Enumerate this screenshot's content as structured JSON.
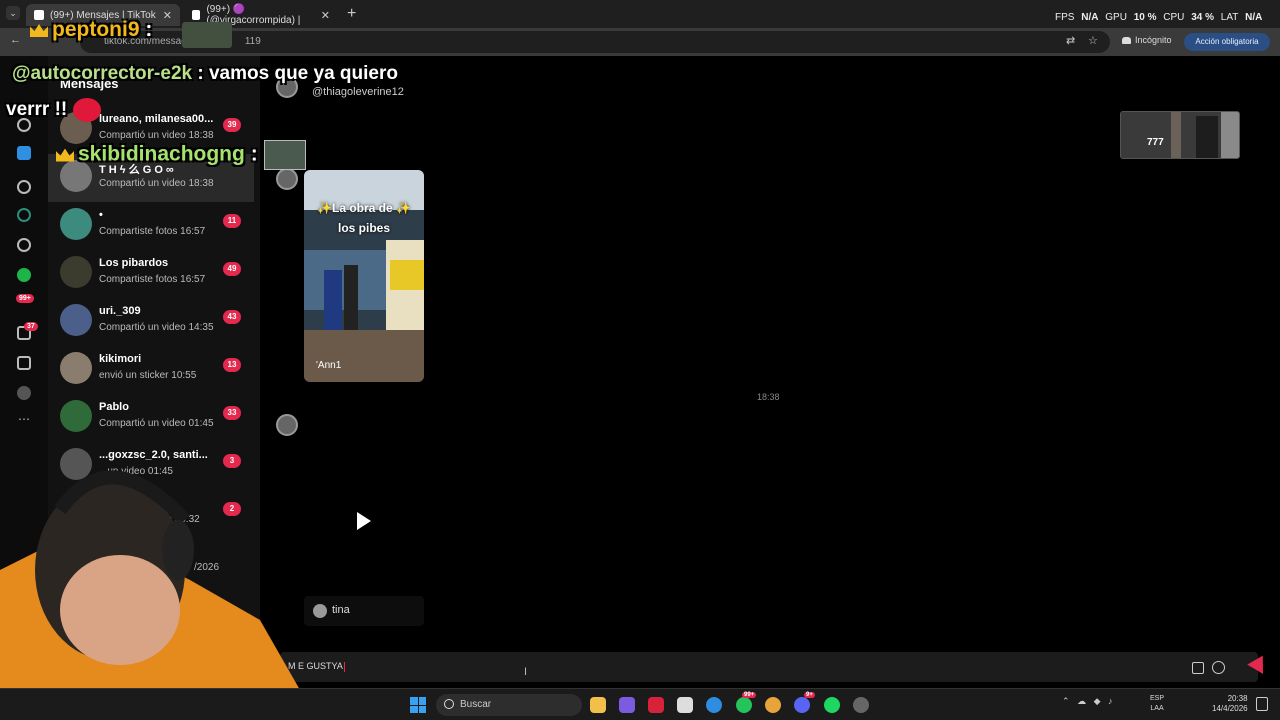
{
  "browser": {
    "tabs": [
      {
        "label": "(99+) Mensajes | TikTok",
        "active": true
      },
      {
        "label": "(99+) 🟣 (@virgacorrompida) |",
        "active": false
      }
    ],
    "new_tab": "+",
    "url": "tiktok.com/messag",
    "url_tail": "119",
    "incognito": "Incógnito",
    "action_button": "Acción obligatoria"
  },
  "perf_overlay": {
    "fps_label": "FPS",
    "fps_value": "N/A",
    "gpu_label": "GPU",
    "gpu_value": "10 %",
    "cpu_label": "CPU",
    "cpu_value": "34 %",
    "lat_label": "LAT",
    "lat_value": "N/A"
  },
  "rail": {
    "badge_notifications": "99+",
    "badge_messages": "37",
    "icons": [
      "home-icon",
      "search-icon",
      "explore-icon",
      "live-icon",
      "following-icon",
      "profile-icon",
      "inbox-icon",
      "messages-icon",
      "upload-icon",
      "more-icon"
    ]
  },
  "messages": {
    "title": "Mensajes",
    "conversations": [
      {
        "name": "lureano, milanesa00...",
        "preview": "Compartió un video 18:38",
        "badge": "39",
        "selected": false
      },
      {
        "name": "T H ϟ 么 G O ∞",
        "preview": "Compartió un video 18:38",
        "badge": "",
        "selected": true
      },
      {
        "name": "•",
        "preview": "Compartiste fotos 16:57",
        "badge": "11",
        "selected": false
      },
      {
        "name": "Los pibardos",
        "preview": "Compartiste fotos 16:57",
        "badge": "49",
        "selected": false
      },
      {
        "name": "uri._309",
        "preview": "Compartió un video 14:35",
        "badge": "43",
        "selected": false
      },
      {
        "name": "kikimori",
        "preview": "envió un sticker 10:55",
        "badge": "13",
        "selected": false
      },
      {
        "name": "Pablo",
        "preview": "Compartió un video 01:45",
        "badge": "33",
        "selected": false
      },
      {
        "name": "...goxzsc_2.0, santi...",
        "preview": "...un video 01:45",
        "badge": "3",
        "selected": false
      },
      {
        "name": "",
        "preview": "...o 00:32",
        "badge": "2",
        "selected": false
      },
      {
        "name": "",
        "preview": "/2026",
        "badge": "",
        "selected": false
      }
    ]
  },
  "chat": {
    "handle": "@thiagoleverine12",
    "video_caption_line1": "✨La obra de ✨",
    "video_caption_line2": "los pibes",
    "video_tag": "'Ann1",
    "timestamp": "18:38",
    "shared_by": "tina",
    "input_value": "M E GUSTYA"
  },
  "stream_overlay": {
    "chat_lines": [
      {
        "user": "peptoni9",
        "text": ":"
      },
      {
        "user": "@autocorrector-e2k",
        "text": ": vamos que ya quiero"
      },
      {
        "user": "",
        "text": "verrr !!"
      },
      {
        "user": "skibidinachogng",
        "text": ":"
      }
    ],
    "viewer_count": "777"
  },
  "taskbar": {
    "search_placeholder": "Buscar",
    "whatsapp_badge": "99+",
    "discord_badge": "9+",
    "lang_line1": "ESP",
    "lang_line2": "LAA",
    "time": "20:38",
    "date": "14/4/2026"
  },
  "colors": {
    "accent": "#e4294f",
    "crown": "#f3b91c",
    "username_green": "#a6e36d",
    "action_blue": "#2b4e84"
  }
}
